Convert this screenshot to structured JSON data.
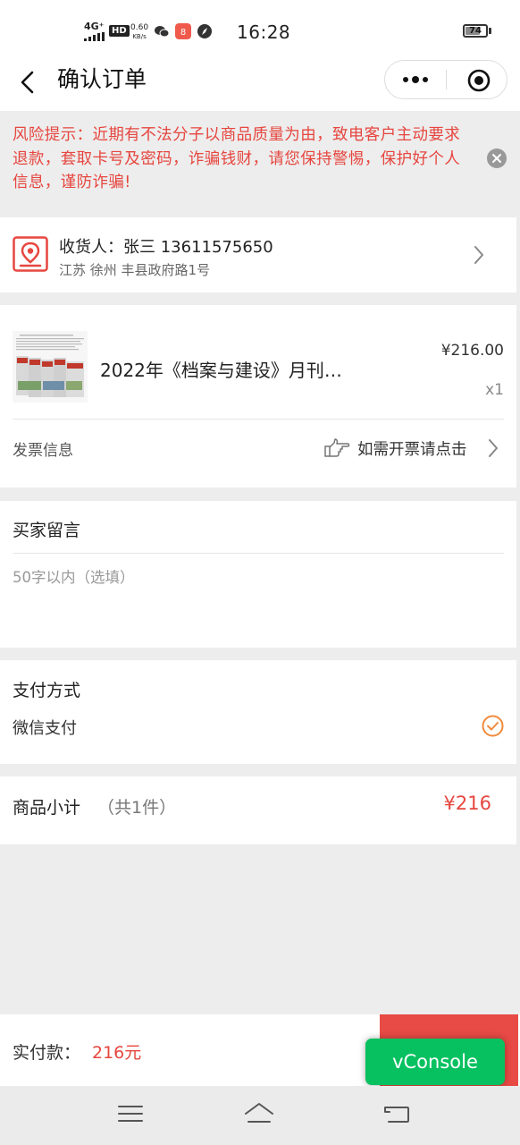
{
  "status_bar": {
    "network": "4G⁺",
    "hd": "HD",
    "speed_value": "0.60",
    "speed_unit": "KB/s",
    "time": "16:28",
    "battery": "74",
    "battery_level": 0.74
  },
  "nav": {
    "title": "确认订单"
  },
  "risk": {
    "text": "风险提示：近期有不法分子以商品质量为由，致电客户主动要求退款，套取卡号及密码，诈骗钱财，请您保持警惕，保护好个人信息，谨防诈骗!"
  },
  "address": {
    "name_line": "收货人：张三 13611575650",
    "detail": "江苏 徐州 丰县政府路1号"
  },
  "product": {
    "name": "2022年《档案与建设》月刊…",
    "price": "¥216.00",
    "qty": "x1"
  },
  "invoice": {
    "label": "发票信息",
    "link": "如需开票请点击"
  },
  "message": {
    "title": "买家留言",
    "placeholder": "50字以内（选填）"
  },
  "payment": {
    "title": "支付方式",
    "method": "微信支付"
  },
  "subtotal": {
    "label": "商品小计",
    "count": "（共1件）",
    "amount": "¥216"
  },
  "footer": {
    "pay_label": "实付款：",
    "pay_amount": "216元",
    "vconsole": "vConsole"
  },
  "colors": {
    "accent_red": "#e6463f",
    "check_orange": "#f08a3c",
    "vconsole_green": "#07c160"
  }
}
